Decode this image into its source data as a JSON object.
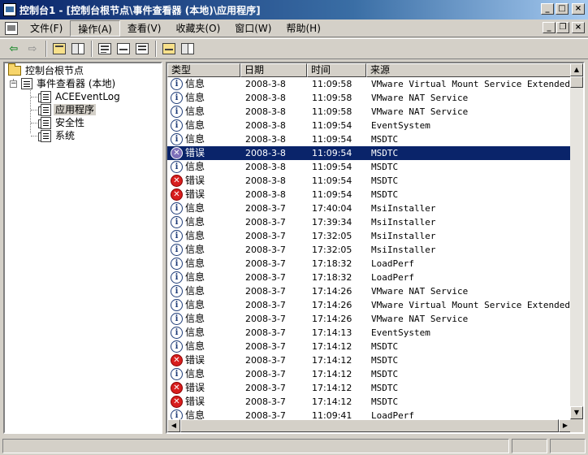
{
  "window": {
    "title": "控制台1 - [控制台根节点\\事件查看器 (本地)\\应用程序]",
    "minimize": "_",
    "maximize": "□",
    "close": "×"
  },
  "mdi_controls": {
    "minimize": "_",
    "restore": "❐",
    "close": "×"
  },
  "menu": {
    "items": [
      "文件(F)",
      "操作(A)",
      "查看(V)",
      "收藏夹(O)",
      "窗口(W)",
      "帮助(H)"
    ]
  },
  "toolbar": {
    "back": "⇦",
    "forward": "⇨"
  },
  "tree": {
    "root": "控制台根节点",
    "event_viewer": "事件查看器 (本地)",
    "logs": [
      "ACEEventLog",
      "应用程序",
      "安全性",
      "系统"
    ],
    "selected_index": 1,
    "expander": "−"
  },
  "list": {
    "columns": [
      "类型",
      "日期",
      "时间",
      "来源"
    ],
    "selected_row": 5,
    "rows": [
      {
        "type": "信息",
        "kind": "info",
        "date": "2008-3-8",
        "time": "11:09:58",
        "source": "VMware Virtual Mount Service Extended"
      },
      {
        "type": "信息",
        "kind": "info",
        "date": "2008-3-8",
        "time": "11:09:58",
        "source": "VMware NAT Service"
      },
      {
        "type": "信息",
        "kind": "info",
        "date": "2008-3-8",
        "time": "11:09:58",
        "source": "VMware NAT Service"
      },
      {
        "type": "信息",
        "kind": "info",
        "date": "2008-3-8",
        "time": "11:09:54",
        "source": "EventSystem"
      },
      {
        "type": "信息",
        "kind": "info",
        "date": "2008-3-8",
        "time": "11:09:54",
        "source": "MSDTC"
      },
      {
        "type": "错误",
        "kind": "error",
        "date": "2008-3-8",
        "time": "11:09:54",
        "source": "MSDTC"
      },
      {
        "type": "信息",
        "kind": "info",
        "date": "2008-3-8",
        "time": "11:09:54",
        "source": "MSDTC"
      },
      {
        "type": "错误",
        "kind": "error",
        "date": "2008-3-8",
        "time": "11:09:54",
        "source": "MSDTC"
      },
      {
        "type": "错误",
        "kind": "error",
        "date": "2008-3-8",
        "time": "11:09:54",
        "source": "MSDTC"
      },
      {
        "type": "信息",
        "kind": "info",
        "date": "2008-3-7",
        "time": "17:40:04",
        "source": "MsiInstaller"
      },
      {
        "type": "信息",
        "kind": "info",
        "date": "2008-3-7",
        "time": "17:39:34",
        "source": "MsiInstaller"
      },
      {
        "type": "信息",
        "kind": "info",
        "date": "2008-3-7",
        "time": "17:32:05",
        "source": "MsiInstaller"
      },
      {
        "type": "信息",
        "kind": "info",
        "date": "2008-3-7",
        "time": "17:32:05",
        "source": "MsiInstaller"
      },
      {
        "type": "信息",
        "kind": "info",
        "date": "2008-3-7",
        "time": "17:18:32",
        "source": "LoadPerf"
      },
      {
        "type": "信息",
        "kind": "info",
        "date": "2008-3-7",
        "time": "17:18:32",
        "source": "LoadPerf"
      },
      {
        "type": "信息",
        "kind": "info",
        "date": "2008-3-7",
        "time": "17:14:26",
        "source": "VMware NAT Service"
      },
      {
        "type": "信息",
        "kind": "info",
        "date": "2008-3-7",
        "time": "17:14:26",
        "source": "VMware Virtual Mount Service Extended"
      },
      {
        "type": "信息",
        "kind": "info",
        "date": "2008-3-7",
        "time": "17:14:26",
        "source": "VMware NAT Service"
      },
      {
        "type": "信息",
        "kind": "info",
        "date": "2008-3-7",
        "time": "17:14:13",
        "source": "EventSystem"
      },
      {
        "type": "信息",
        "kind": "info",
        "date": "2008-3-7",
        "time": "17:14:12",
        "source": "MSDTC"
      },
      {
        "type": "错误",
        "kind": "error",
        "date": "2008-3-7",
        "time": "17:14:12",
        "source": "MSDTC"
      },
      {
        "type": "信息",
        "kind": "info",
        "date": "2008-3-7",
        "time": "17:14:12",
        "source": "MSDTC"
      },
      {
        "type": "错误",
        "kind": "error",
        "date": "2008-3-7",
        "time": "17:14:12",
        "source": "MSDTC"
      },
      {
        "type": "错误",
        "kind": "error",
        "date": "2008-3-7",
        "time": "17:14:12",
        "source": "MSDTC"
      },
      {
        "type": "信息",
        "kind": "info",
        "date": "2008-3-7",
        "time": "11:09:41",
        "source": "LoadPerf"
      }
    ]
  },
  "icons": {
    "info": "i",
    "error": "✕",
    "scroll_up": "▲",
    "scroll_down": "▼",
    "scroll_left": "◀",
    "scroll_right": "▶"
  }
}
